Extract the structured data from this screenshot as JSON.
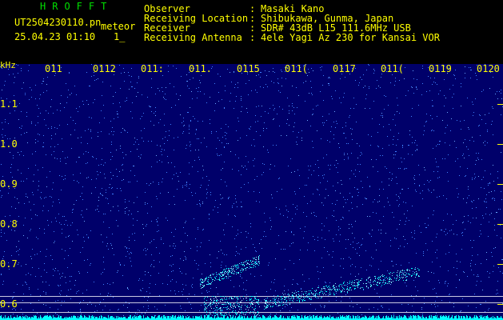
{
  "header": {
    "brand": "HROFFT",
    "filename": "UT2504230110.pn",
    "meteor_tag": "meteor",
    "datetime": "25.04.23 01:10",
    "misc": "1_",
    "info": [
      {
        "label": "Observer",
        "value": "Masaki Kano"
      },
      {
        "label": "Receiving Location",
        "value": "Shibukawa, Gunma, Japan"
      },
      {
        "label": "Receiver",
        "value": "SDR# 43dB L15 111.6MHz USB"
      },
      {
        "label": "Receiving Antenna",
        "value": "4ele Yagi Az 230 for Kansai VOR"
      }
    ],
    "separator": ":"
  },
  "axes": {
    "unit": "kHz",
    "time_ticks": [
      "011",
      "0112",
      "011:",
      "011.",
      "0115",
      "011(",
      "0117",
      "011(",
      "0119",
      "0120"
    ],
    "freq_ticks": [
      "1.1",
      "1.0",
      "0.9",
      "0.8",
      "0.7",
      "0.6"
    ]
  },
  "colors": {
    "text": "#ffff00",
    "brand": "#00e000",
    "background": "#000000",
    "plot_bg": "#00006a",
    "noise": "#4080ff",
    "signal": "#00ffff"
  }
}
